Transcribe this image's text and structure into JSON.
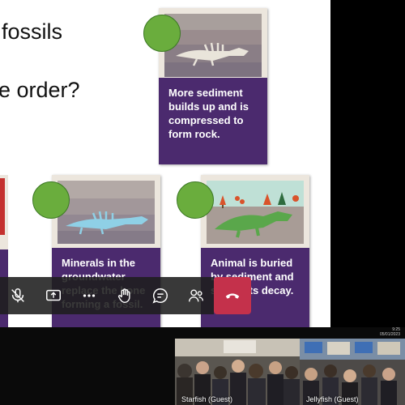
{
  "slide": {
    "title_line1": "fossils",
    "title_line2": "e order?",
    "cards": [
      {
        "caption": "More sediment builds up and is compressed to form rock."
      },
      {
        "caption": "Minerals in the groundwater replace the bone forming a fossil."
      },
      {
        "caption": "Animal is buried by sediment and soft parts decay."
      }
    ]
  },
  "meeting_controls": [
    {
      "name": "mic-off-icon"
    },
    {
      "name": "share-screen-icon"
    },
    {
      "name": "more-options-icon"
    },
    {
      "name": "raise-hand-icon"
    },
    {
      "name": "chat-icon"
    },
    {
      "name": "participants-icon"
    },
    {
      "name": "hang-up-icon"
    }
  ],
  "clock": {
    "time": "9:25",
    "date": "05/01/2023"
  },
  "participants": [
    {
      "label": "Starfish (Guest)"
    },
    {
      "label": "Jellyfish (Guest)"
    }
  ],
  "colors": {
    "card_caption_bg": "#4b2a6e",
    "card_bg": "#ece6dd",
    "dot_green": "#6aad3d",
    "hangup_red": "#c4314b"
  }
}
